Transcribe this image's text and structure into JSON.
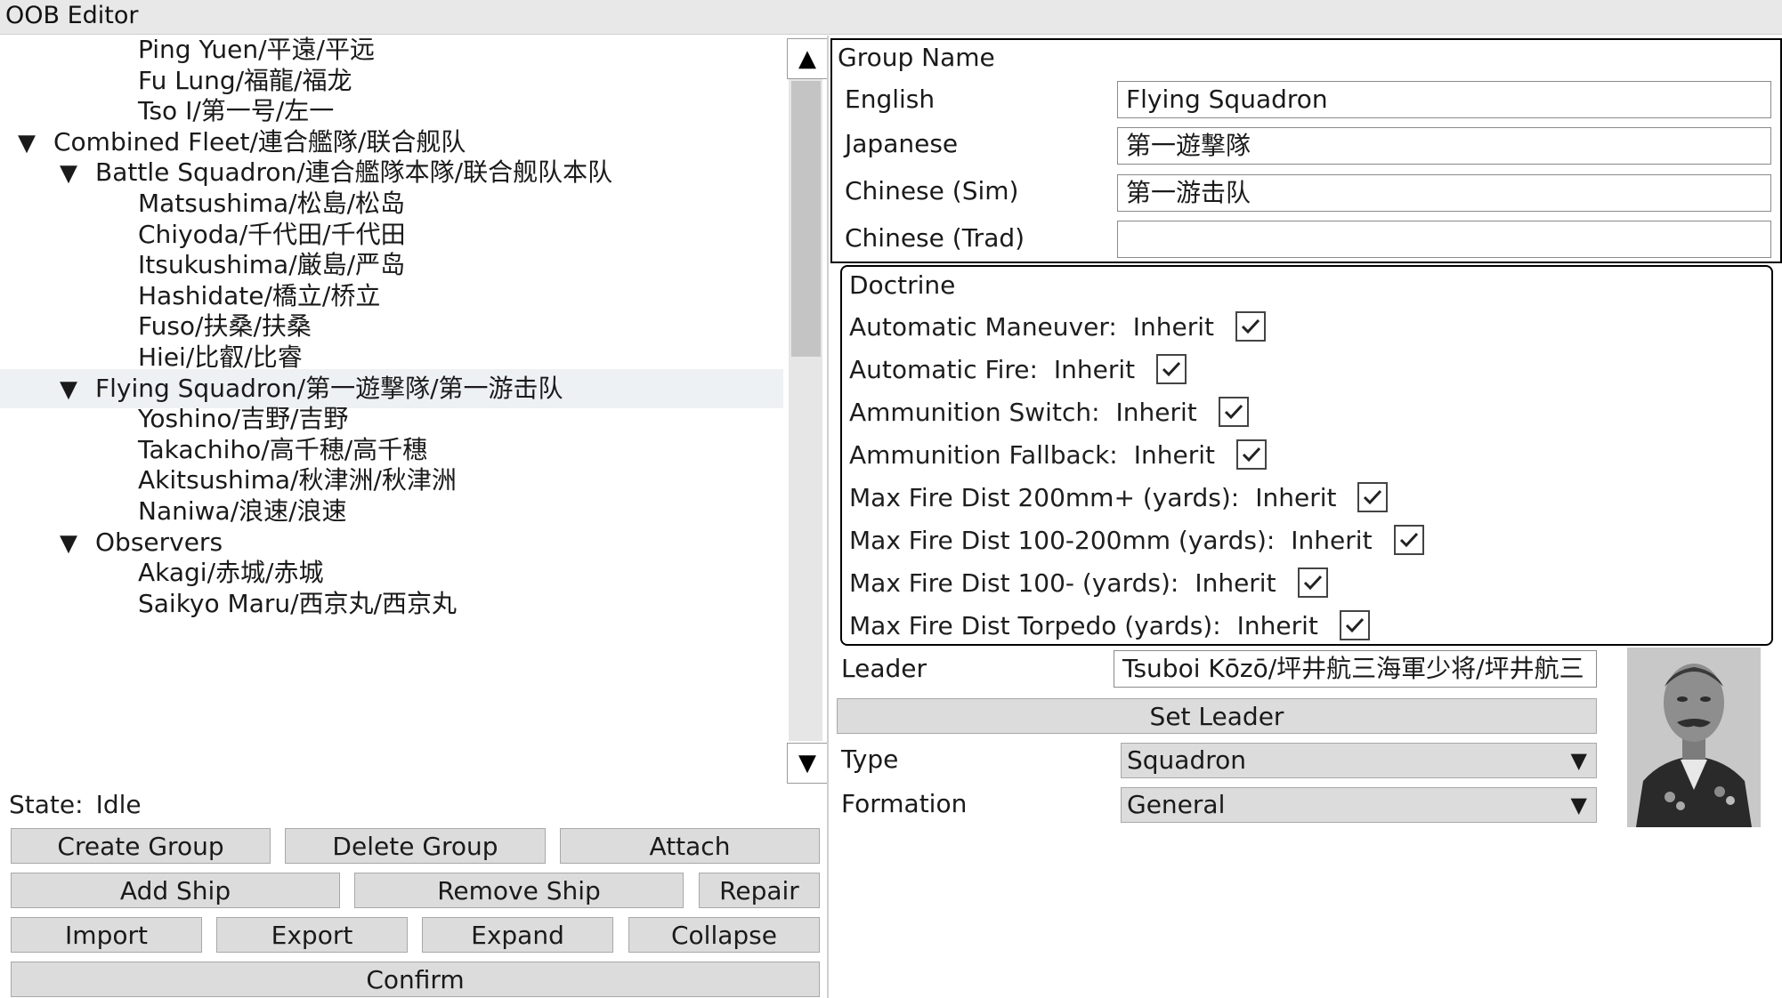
{
  "window": {
    "title": "OOB Editor"
  },
  "tree": {
    "nodes": [
      {
        "label": "Ping Yuen/平遠/平远",
        "depth": 2,
        "arrow": "",
        "selected": false
      },
      {
        "label": "Fu Lung/福龍/福龙",
        "depth": 2,
        "arrow": "",
        "selected": false
      },
      {
        "label": "Tso I/第一号/左一",
        "depth": 2,
        "arrow": "",
        "selected": false
      },
      {
        "label": "Combined Fleet/連合艦隊/联合舰队",
        "depth": 0,
        "arrow": "▼",
        "selected": false
      },
      {
        "label": "Battle Squadron/連合艦隊本隊/联合舰队本队",
        "depth": 1,
        "arrow": "▼",
        "selected": false
      },
      {
        "label": "Matsushima/松島/松岛",
        "depth": 2,
        "arrow": "",
        "selected": false
      },
      {
        "label": "Chiyoda/千代田/千代田",
        "depth": 2,
        "arrow": "",
        "selected": false
      },
      {
        "label": "Itsukushima/厳島/严岛",
        "depth": 2,
        "arrow": "",
        "selected": false
      },
      {
        "label": "Hashidate/橋立/桥立",
        "depth": 2,
        "arrow": "",
        "selected": false
      },
      {
        "label": "Fuso/扶桑/扶桑",
        "depth": 2,
        "arrow": "",
        "selected": false
      },
      {
        "label": "Hiei/比叡/比睿",
        "depth": 2,
        "arrow": "",
        "selected": false
      },
      {
        "label": "Flying Squadron/第一遊撃隊/第一游击队",
        "depth": 1,
        "arrow": "▼",
        "selected": true
      },
      {
        "label": "Yoshino/吉野/吉野",
        "depth": 2,
        "arrow": "",
        "selected": false
      },
      {
        "label": "Takachiho/高千穂/高千穗",
        "depth": 2,
        "arrow": "",
        "selected": false
      },
      {
        "label": "Akitsushima/秋津洲/秋津洲",
        "depth": 2,
        "arrow": "",
        "selected": false
      },
      {
        "label": "Naniwa/浪速/浪速",
        "depth": 2,
        "arrow": "",
        "selected": false
      },
      {
        "label": "Observers",
        "depth": 1,
        "arrow": "▼",
        "selected": false
      },
      {
        "label": "Akagi/赤城/赤城",
        "depth": 2,
        "arrow": "",
        "selected": false
      },
      {
        "label": "Saikyo Maru/西京丸/西京丸",
        "depth": 2,
        "arrow": "",
        "selected": false
      }
    ],
    "scroll_up_icon": "▲",
    "scroll_down_icon": "▼"
  },
  "status": {
    "label": "State:",
    "value": "Idle"
  },
  "buttons": {
    "create_group": "Create Group",
    "delete_group": "Delete Group",
    "attach": "Attach",
    "add_ship": "Add Ship",
    "remove_ship": "Remove Ship",
    "repair": "Repair",
    "import": "Import",
    "export": "Export",
    "expand": "Expand",
    "collapse": "Collapse",
    "confirm": "Confirm"
  },
  "group_name": {
    "title": "Group Name",
    "english_label": "English",
    "english_value": "Flying Squadron",
    "japanese_label": "Japanese",
    "japanese_value": "第一遊撃隊",
    "chinese_sim_label": "Chinese (Sim)",
    "chinese_sim_value": "第一游击队",
    "chinese_trad_label": "Chinese (Trad)",
    "chinese_trad_value": ""
  },
  "doctrine": {
    "title": "Doctrine",
    "items": [
      {
        "label": "Automatic Maneuver:",
        "value": "Inherit",
        "checked": true
      },
      {
        "label": "Automatic Fire:",
        "value": "Inherit",
        "checked": true
      },
      {
        "label": "Ammunition Switch:",
        "value": "Inherit",
        "checked": true
      },
      {
        "label": "Ammunition Fallback:",
        "value": "Inherit",
        "checked": true
      },
      {
        "label": "Max Fire Dist 200mm+ (yards):",
        "value": "Inherit",
        "checked": true
      },
      {
        "label": "Max Fire Dist 100-200mm (yards):",
        "value": "Inherit",
        "checked": true
      },
      {
        "label": "Max Fire Dist 100- (yards):",
        "value": "Inherit",
        "checked": true
      },
      {
        "label": "Max Fire Dist Torpedo (yards):",
        "value": "Inherit",
        "checked": true
      }
    ]
  },
  "leader": {
    "label": "Leader",
    "value": "Tsuboi Kōzō/坪井航三海軍少将/坪井航三",
    "set_button": "Set Leader"
  },
  "type": {
    "label": "Type",
    "value": "Squadron",
    "caret": "▼"
  },
  "formation": {
    "label": "Formation",
    "value": "General",
    "caret": "▼"
  },
  "colors": {
    "button_bg": "#dcdcdc",
    "selected_row": "#eef1f4",
    "panel_border": "#000000"
  }
}
